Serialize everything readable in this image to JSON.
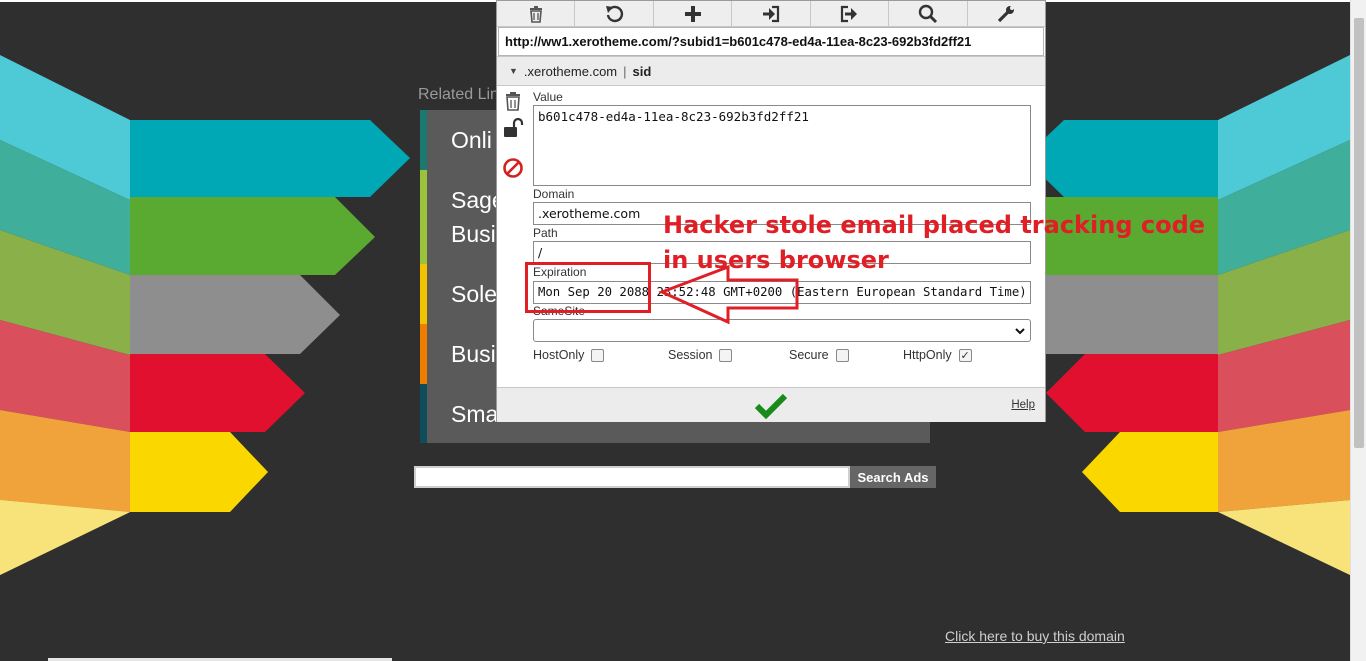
{
  "page": {
    "related_links_title": "Related Links",
    "related_links": [
      {
        "label": "Onli",
        "accent": "#1b7a6f"
      },
      {
        "label": "Sage\nBusi",
        "accent": "#9bc23c"
      },
      {
        "label": "Sole",
        "accent": "#f2c400"
      },
      {
        "label": "Busi",
        "accent": "#ef7d00"
      },
      {
        "label": "Sma",
        "accent": "#0f4c5c"
      }
    ],
    "search_button": "Search Ads",
    "search_placeholder": "",
    "buy_domain_link": "Click here to buy this domain"
  },
  "cookie_editor": {
    "toolbar": [
      {
        "name": "delete-all-icon",
        "symbol": "trash"
      },
      {
        "name": "reset-icon",
        "symbol": "undo"
      },
      {
        "name": "add-icon",
        "symbol": "plus"
      },
      {
        "name": "import-icon",
        "symbol": "sign-in"
      },
      {
        "name": "export-icon",
        "symbol": "sign-out"
      },
      {
        "name": "search-icon",
        "symbol": "magnifier"
      },
      {
        "name": "settings-icon",
        "symbol": "wrench"
      }
    ],
    "url": "http://ww1.xerotheme.com/?subid1=b601c478-ed4a-11ea-8c23-692b3fd2ff21",
    "cookie_domain": ".xerotheme.com",
    "cookie_separator": "|",
    "cookie_name": "sid",
    "value_label": "Value",
    "value": "b601c478-ed4a-11ea-8c23-692b3fd2ff21",
    "domain_label": "Domain",
    "domain": ".xerotheme.com",
    "path_label": "Path",
    "path": "/",
    "expiration_label": "Expiration",
    "expiration": "Mon Sep 20 2088 23:52:48 GMT+0200 (Eastern European Standard Time)",
    "samesite_label": "SameSite",
    "samesite_value": "",
    "flags": [
      {
        "label": "HostOnly",
        "checked": false
      },
      {
        "label": "Session",
        "checked": false
      },
      {
        "label": "Secure",
        "checked": false
      },
      {
        "label": "HttpOnly",
        "checked": true
      }
    ],
    "help_link": "Help",
    "accent_colors": {
      "save_check": "#1a8a1a",
      "block": "#d42020"
    }
  },
  "annotation": {
    "line1": "Hacker stole email placed tracking code",
    "line2": "in users browser",
    "color": "#e01e25"
  }
}
